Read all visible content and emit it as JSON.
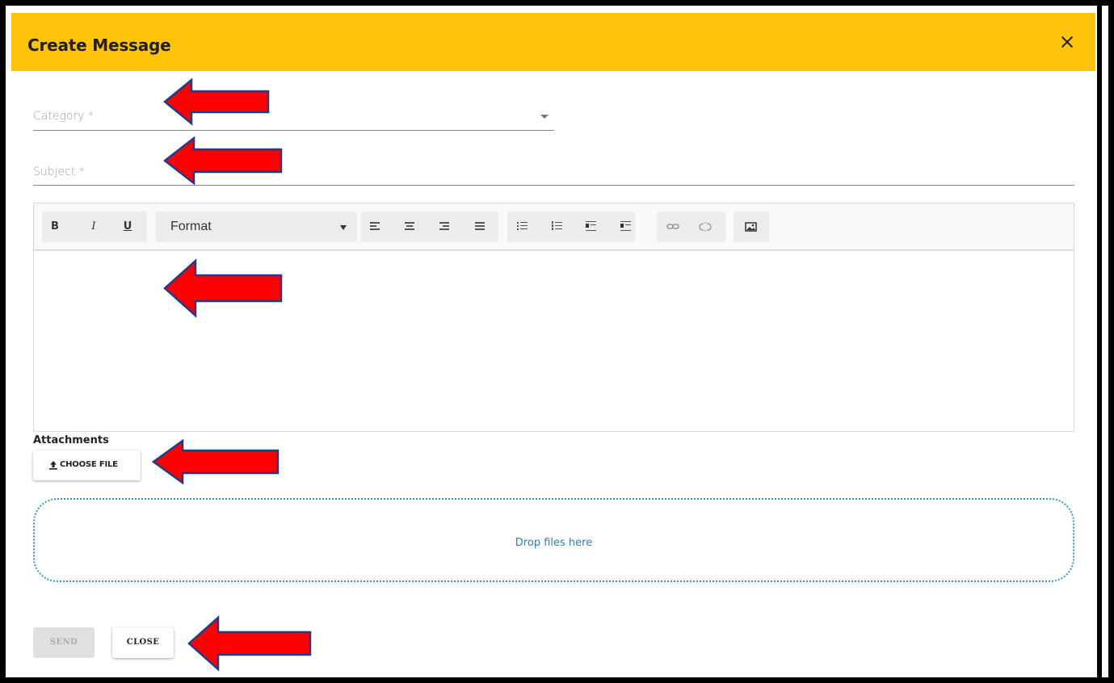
{
  "dialog": {
    "title": "Create Message"
  },
  "form": {
    "category_label": "Category *",
    "subject_label": "Subject *"
  },
  "editor": {
    "format_label": "Format",
    "toolbar_buttons": {
      "bold": "B",
      "italic": "I",
      "underline": "U"
    }
  },
  "attachments": {
    "label": "Attachments",
    "choose_file_label": "CHOOSE FILE",
    "drop_text": "Drop files here"
  },
  "actions": {
    "send_label": "SEND",
    "close_label": "CLOSE"
  },
  "colors": {
    "header": "#ffc408",
    "arrow_fill": "#ff0000",
    "arrow_outline": "#1f3c88",
    "dropzone_border": "#3a95d6"
  }
}
